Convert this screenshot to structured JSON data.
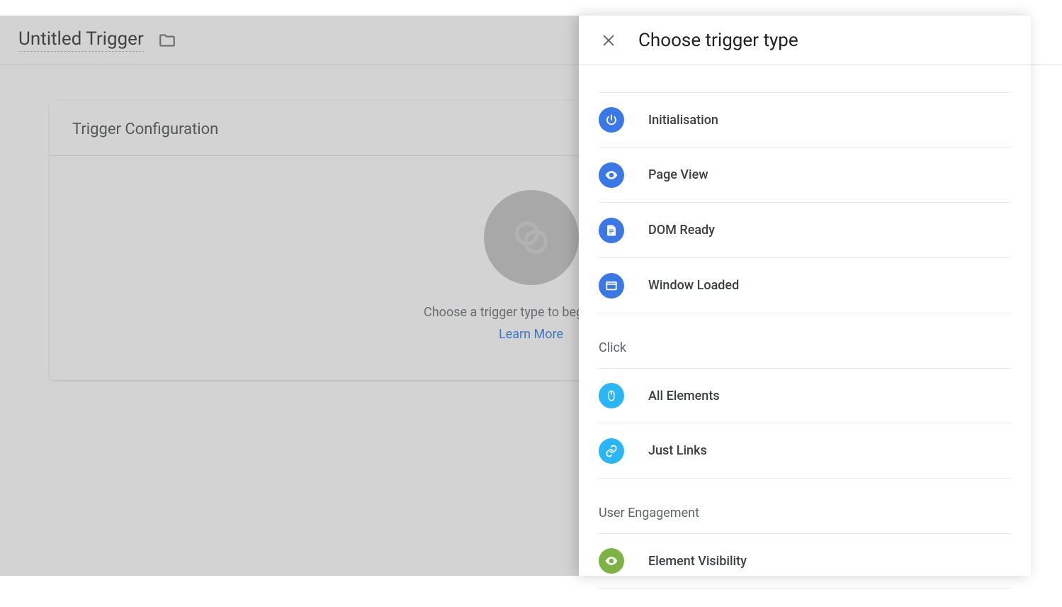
{
  "header": {
    "title": "Untitled Trigger"
  },
  "card": {
    "title": "Trigger Configuration",
    "helper": "Choose a trigger type to begin setup...",
    "learn_more": "Learn More"
  },
  "panel": {
    "title": "Choose trigger type",
    "groups": [
      {
        "label": "",
        "items": [
          {
            "icon": "power-icon",
            "color": "blue",
            "label": "Initialisation"
          },
          {
            "icon": "eye-icon",
            "color": "blue",
            "label": "Page View"
          },
          {
            "icon": "file-icon",
            "color": "blue",
            "label": "DOM Ready"
          },
          {
            "icon": "window-icon",
            "color": "blue",
            "label": "Window Loaded"
          }
        ]
      },
      {
        "label": "Click",
        "items": [
          {
            "icon": "mouse-icon",
            "color": "cyan",
            "label": "All Elements"
          },
          {
            "icon": "link-icon",
            "color": "cyan",
            "label": "Just Links"
          }
        ]
      },
      {
        "label": "User Engagement",
        "items": [
          {
            "icon": "visibility-icon",
            "color": "green",
            "label": "Element Visibility"
          }
        ]
      }
    ]
  }
}
